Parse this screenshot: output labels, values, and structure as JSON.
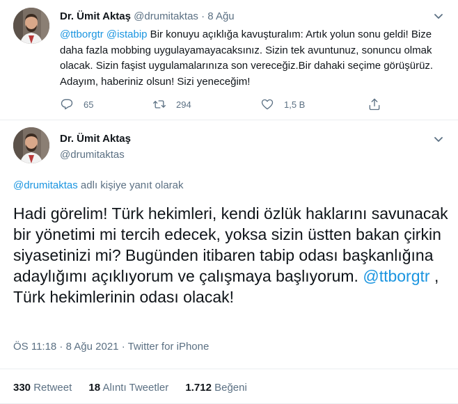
{
  "parent_tweet": {
    "name": "Dr. Ümit Aktaş",
    "handle": "@drumitaktas",
    "separator": "·",
    "date": "8 Ağu",
    "text_parts": [
      {
        "text": "@ttborgtr",
        "link": true
      },
      {
        "text": " ",
        "link": false
      },
      {
        "text": "@istabip",
        "link": true
      },
      {
        "text": " Bir konuyu açıklığa kavuşturalım: Artık yolun sonu geldi! Bize daha fazla mobbing uygulayamayacaksınız. Sizin tek avuntunuz, sonuncu olmak olacak. Sizin faşist uygulamalarınıza son vereceğiz.Bir dahaki seçime görüşürüz. Adayım, haberiniz olsun! Sizi yeneceğim!",
        "link": false
      }
    ],
    "reply_count": "65",
    "retweet_count": "294",
    "like_count": "1,5 B"
  },
  "main_tweet": {
    "name": "Dr. Ümit Aktaş",
    "handle": "@drumitaktas",
    "reply_to_handle": "@drumitaktas",
    "reply_to_suffix": " adlı kişiye yanıt olarak",
    "text_before": "Hadi görelim! Türk hekimleri, kendi özlük haklarını savunacak bir yönetimi mi tercih edecek, yoksa sizin üstten bakan çirkin siyasetinizi mi? Bugünden itibaren tabip odası başkanlığına adaylığımı açıklıyorum ve çalışmaya başlıyorum. ",
    "mention": "@ttborgtr",
    "text_after": " , Türk hekimlerinin odası olacak!",
    "time": "ÖS 11:18",
    "date": "8 Ağu 2021",
    "source": "Twitter for iPhone",
    "meta_separator": " · ",
    "retweets": "330",
    "retweets_label": "Retweet",
    "quotes": "18",
    "quotes_label": "Alıntı Tweetler",
    "likes": "1.712",
    "likes_label": "Beğeni"
  },
  "colors": {
    "link": "#1b95e0",
    "muted": "#5b7083",
    "text": "#0f1419",
    "divider": "#ebeef0"
  },
  "icons": {
    "more": "chevron-down-icon",
    "reply": "reply-icon",
    "retweet": "retweet-icon",
    "like": "heart-icon",
    "share": "share-icon"
  }
}
